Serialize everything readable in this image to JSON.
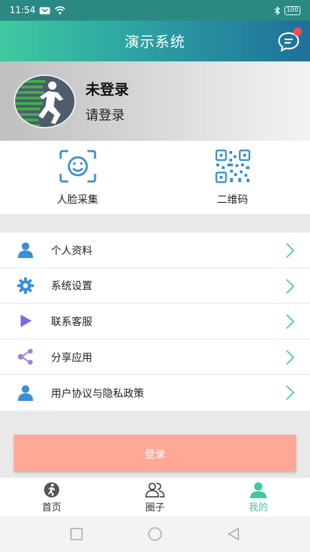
{
  "status": {
    "time": "11:54",
    "battery": "100"
  },
  "header": {
    "title": "演示系统"
  },
  "profile": {
    "name": "未登录",
    "subtitle": "请登录"
  },
  "quick_actions": [
    {
      "label": "人脸采集",
      "icon": "face-scan-icon"
    },
    {
      "label": "二维码",
      "icon": "qr-code-icon"
    }
  ],
  "menu": [
    {
      "label": "个人资料",
      "icon": "person-icon"
    },
    {
      "label": "系统设置",
      "icon": "gear-icon"
    },
    {
      "label": "联系客服",
      "icon": "play-icon"
    },
    {
      "label": "分享应用",
      "icon": "share-icon"
    },
    {
      "label": "用户协议与隐私政策",
      "icon": "person-icon"
    }
  ],
  "login": {
    "label": "登录"
  },
  "tabs": [
    {
      "label": "首页",
      "icon": "runner-icon"
    },
    {
      "label": "圈子",
      "icon": "group-icon"
    },
    {
      "label": "我的",
      "icon": "person-icon",
      "active": true
    }
  ],
  "colors": {
    "accent": "#3fc9a0",
    "login": "#ffa898",
    "icon_blue": "#3a8fd6"
  }
}
